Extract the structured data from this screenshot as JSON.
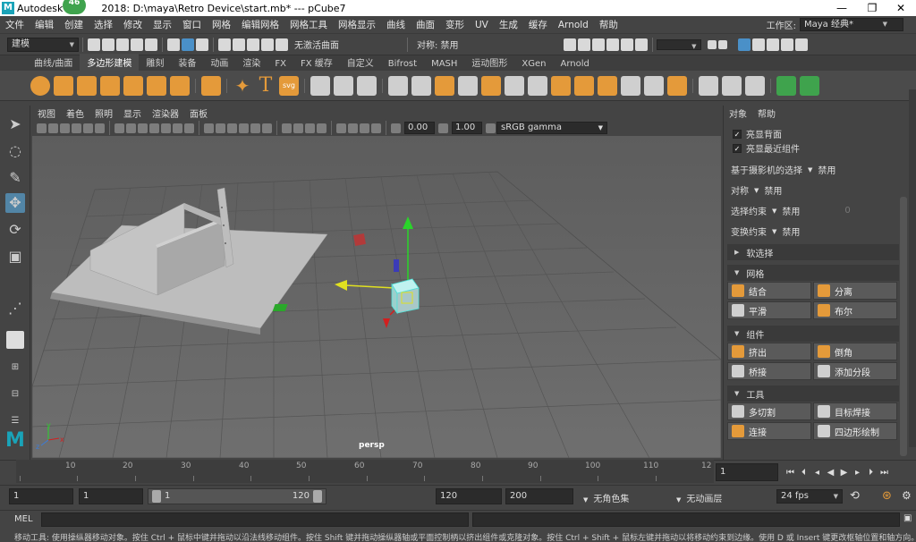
{
  "titlebar": {
    "app": "Autodesk M",
    "badge": "46",
    "rest": "2018: D:\\maya\\Retro Device\\start.mb*  ---  pCube7",
    "minimize_icon": "minimize-icon",
    "restore_icon": "restore-icon",
    "close_icon": "close-icon"
  },
  "menubar": {
    "items": [
      "文件",
      "编辑",
      "创建",
      "选择",
      "修改",
      "显示",
      "窗口",
      "网格",
      "编辑网格",
      "网格工具",
      "网格显示",
      "曲线",
      "曲面",
      "变形",
      "UV",
      "生成",
      "缓存",
      "Arnold",
      "帮助"
    ],
    "workspace_label": "工作区:",
    "workspace_value": "Maya 经典*"
  },
  "statusline": {
    "mode_dropdown": "建模",
    "live_surface": "无激活曲面",
    "symmetry": "对称: 禁用"
  },
  "shelf": {
    "tabs": [
      "曲线/曲面",
      "多边形建模",
      "雕刻",
      "装备",
      "动画",
      "渲染",
      "FX",
      "FX 缓存",
      "自定义",
      "Bifrost",
      "MASH",
      "运动图形",
      "XGen",
      "Arnold"
    ],
    "active_tab": 1,
    "text_tool": "T",
    "svg_tool": "svg"
  },
  "viewport": {
    "menu": [
      "视图",
      "着色",
      "照明",
      "显示",
      "渲染器",
      "面板"
    ],
    "exposure": "0.00",
    "gamma": "1.00",
    "colorspace": "sRGB gamma",
    "camera": "persp",
    "axis_x": "x",
    "axis_y": "y",
    "axis_z": "z"
  },
  "attr": {
    "tabs": [
      "对象",
      "帮助"
    ],
    "chk_backface": "亮显背面",
    "chk_recent": "亮显最近组件",
    "camera_select": "基于摄影机的选择",
    "camera_select_val": "禁用",
    "symmetry": "对称",
    "symmetry_val": "禁用",
    "select_constraint": "选择约束",
    "select_constraint_val": "禁用",
    "select_constraint_num": "0",
    "transform_constraint": "变换约束",
    "transform_constraint_val": "禁用",
    "soft_select": "软选择",
    "section_mesh": "网格",
    "combine": "结合",
    "separate": "分离",
    "smooth": "平滑",
    "boolean": "布尔",
    "section_component": "组件",
    "extrude": "挤出",
    "bevel": "倒角",
    "bridge": "桥接",
    "add_divisions": "添加分段",
    "section_tools": "工具",
    "multicut": "多切割",
    "target_weld": "目标焊接",
    "connect": "连接",
    "quad_draw": "四边形绘制"
  },
  "timeline": {
    "ticks": [
      "10",
      "20",
      "30",
      "40",
      "50",
      "60",
      "70",
      "80",
      "90",
      "100",
      "110",
      "12"
    ],
    "current": "1"
  },
  "range": {
    "start": "1",
    "playback_start": "1",
    "slider_start": "1",
    "slider_end": "120",
    "playback_end": "120",
    "end": "200",
    "char_set": "无角色集",
    "anim_layer": "无动画层",
    "fps": "24 fps"
  },
  "mel": {
    "label": "MEL"
  },
  "help": {
    "text": "移动工具: 使用操纵器移动对象。按住 Ctrl + 鼠标中键并拖动以沿法线移动组件。按住 Shift 键并拖动操纵器轴或平面控制柄以挤出组件或克隆对象。按住 Ctrl + Shift + 鼠标左键并拖动以将移动约束到边缘。使用 D 或 Insert 键更改枢轴位置和轴方向。"
  }
}
